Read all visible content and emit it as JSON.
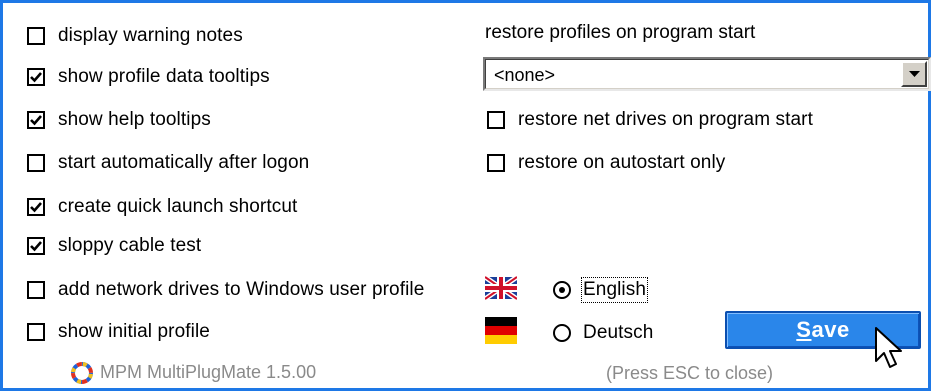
{
  "options_left": [
    {
      "label": "display warning notes",
      "checked": false
    },
    {
      "label": "show profile data tooltips",
      "checked": true
    },
    {
      "label": "show help tooltips",
      "checked": true
    },
    {
      "label": "start automatically after logon",
      "checked": false
    },
    {
      "label": "create quick launch shortcut",
      "checked": true
    },
    {
      "label": "sloppy cable test",
      "checked": true
    },
    {
      "label": "add network drives to Windows user profile",
      "checked": false
    },
    {
      "label": "show initial profile",
      "checked": false
    }
  ],
  "restore": {
    "heading": "restore profiles on program start",
    "selected_profile": "<none>",
    "net_drives_label": "restore net drives on program start",
    "net_drives_checked": false,
    "autostart_only_label": "restore on autostart only",
    "autostart_only_checked": false
  },
  "language": {
    "options": [
      {
        "label": "English",
        "selected": true,
        "flag": "uk-flag-icon"
      },
      {
        "label": "Deutsch",
        "selected": false,
        "flag": "germany-flag-icon"
      }
    ]
  },
  "save_button": {
    "label_underlined": "S",
    "label_rest": "ave"
  },
  "footer": {
    "app_name": "MPM MultiPlugMate 1.5.00",
    "hint": "(Press ESC to close)"
  },
  "colors": {
    "frame_border": "#1e78e6",
    "save_button_bg": "#2a86ea",
    "footer_text": "#8a8a8a"
  }
}
